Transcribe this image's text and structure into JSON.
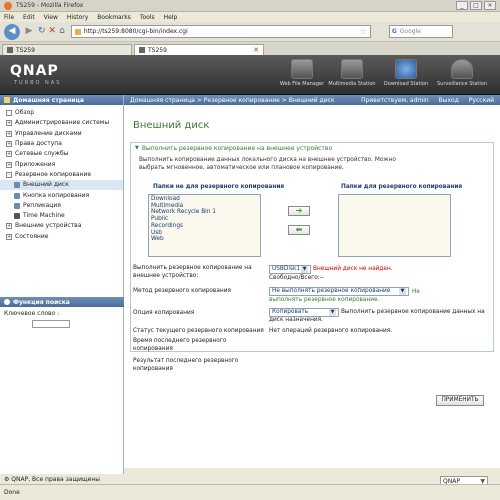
{
  "window": {
    "title": "TS259 - Mozilla Firefox"
  },
  "menu": [
    "File",
    "Edit",
    "View",
    "History",
    "Bookmarks",
    "Tools",
    "Help"
  ],
  "nav": {
    "url": "http://ts259:8080/cgi-bin/index.cgi",
    "search_placeholder": "Google"
  },
  "tabs": [
    {
      "label": "TS259"
    },
    {
      "label": "TS259"
    }
  ],
  "header": {
    "logo": "QNAP",
    "logo_sub": "TURBO NAS",
    "icons": [
      {
        "label": "Web File Manager"
      },
      {
        "label": "Multimedia Station"
      },
      {
        "label": "Download Station"
      },
      {
        "label": "Surveillance Station"
      }
    ]
  },
  "sidebar": {
    "home": "Домашняя страница",
    "items": [
      {
        "label": "Обзор",
        "box": "",
        "level": 0
      },
      {
        "label": "Администрирование системы",
        "box": "+",
        "level": 0
      },
      {
        "label": "Управление дисками",
        "box": "+",
        "level": 0
      },
      {
        "label": "Права доступа",
        "box": "+",
        "level": 0
      },
      {
        "label": "Сетевые службы",
        "box": "+",
        "level": 0
      },
      {
        "label": "Приложения",
        "box": "+",
        "level": 0
      },
      {
        "label": "Резервное копирование",
        "box": "-",
        "level": 0
      },
      {
        "label": "Внешний диск",
        "box": "",
        "level": 1
      },
      {
        "label": "Кнопка копирования",
        "box": "",
        "level": 1
      },
      {
        "label": "Репликация",
        "box": "",
        "level": 1
      },
      {
        "label": "Time Machine",
        "box": "",
        "level": 1
      },
      {
        "label": "Внешние устройства",
        "box": "+",
        "level": 0
      },
      {
        "label": "Состояние",
        "box": "+",
        "level": 0
      }
    ],
    "search_title": "Функция поиска",
    "search_label": "Ключевое слово :",
    "footer": "QNAP, Все права защищены"
  },
  "breadcrumb": {
    "path": "Домашняя страница > Резервное копирование > Внешний диск",
    "welcome": "Приветствуем, admin",
    "logout": "Выход",
    "lang": "Русский"
  },
  "main": {
    "title": "Внешний диск",
    "panel_title": "Выполнить резервное копирование на внешнее устройство",
    "description": "Выполнить копирование данных локального диска на внешнее устройство. Можно выбрать мгновенное, автоматическое или плановое копирование.",
    "left_header": "Папки не для резервного копирования",
    "right_header": "Папки для резервного копирования",
    "folders": [
      "Download",
      "Multimedia",
      "Network Recycle Bin 1",
      "Public",
      "Recordings",
      "Usb",
      "Web"
    ],
    "add_arrow": "➔",
    "remove_arrow": "⬅",
    "device_label": "Выполнить резервное копирование на внешнее устройство:",
    "device_value": "USBDisk1",
    "device_error": "Внешний диск не найден.",
    "free_label": "Свободно/Всего:",
    "free_value": "--",
    "method_label": "Метод резервного копирования",
    "method_value": "Не выполнять резервное копирование",
    "method_note": "Не выполнять резервное копирование.",
    "option_label": "Опция копирования",
    "option_value": "Копировать",
    "option_note": "Выполнить резервное копирование данных на диск назначения.",
    "status_label": "Статус текущего резервного копирования",
    "status_value": "Нет операций резервного копирования.",
    "last_time_label": "Время последнего резервного копирования",
    "last_result_label": "Результат последнего резервного копирования",
    "apply": "ПРИМЕНИТЬ"
  },
  "qnap_class": "QNAP Classic",
  "status": "Done"
}
